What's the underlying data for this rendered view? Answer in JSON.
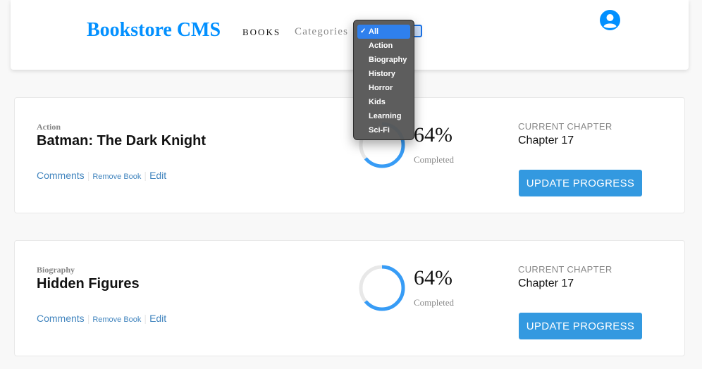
{
  "header": {
    "brand": "Bookstore CMS",
    "nav_books": "BOOKS",
    "nav_categories": "Categories",
    "user_icon": "user-circle-icon"
  },
  "dropdown": {
    "options": [
      "All",
      "Action",
      "Biography",
      "History",
      "Horror",
      "Kids",
      "Learning",
      "Sci-Fi"
    ],
    "selected": "All",
    "check": "✓"
  },
  "books": [
    {
      "genre": "Action",
      "title": "Batman: The Dark Knight",
      "comments": "Comments",
      "remove": "Remove Book",
      "edit": "Edit",
      "percent": "64%",
      "progress": 0.64,
      "completed": "Completed",
      "chapter_label": "CURRENT CHAPTER",
      "chapter": "Chapter 17",
      "update": "UPDATE PROGRESS"
    },
    {
      "genre": "Biography",
      "title": "Hidden Figures",
      "comments": "Comments",
      "remove": "Remove Book",
      "edit": "Edit",
      "percent": "64%",
      "progress": 0.64,
      "completed": "Completed",
      "chapter_label": "CURRENT CHAPTER",
      "chapter": "Chapter 17",
      "update": "UPDATE PROGRESS"
    }
  ],
  "colors": {
    "accent": "#0290ff",
    "button": "#3399e0",
    "ring": "#379cf6",
    "link": "#4386bf"
  }
}
